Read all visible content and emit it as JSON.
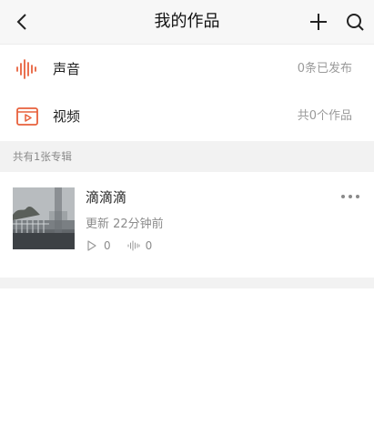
{
  "header": {
    "title": "我的作品",
    "back_icon": "chevron-left-icon",
    "add_icon": "plus-icon",
    "search_icon": "search-icon"
  },
  "rows": [
    {
      "icon": "audio-waveform-icon",
      "label": "声音",
      "meta": "0条已发布",
      "accent": "#e8613c"
    },
    {
      "icon": "video-play-icon",
      "label": "视频",
      "meta": "共0个作品",
      "accent": "#e8613c"
    }
  ],
  "section": {
    "label": "共有1张专辑"
  },
  "albums": [
    {
      "title": "滴滴滴",
      "updated": "更新 22分钟前",
      "plays": "0",
      "tracks": "0",
      "more_icon": "more-horizontal-icon",
      "play_icon": "play-outline-icon",
      "tracks_icon": "audio-waveform-icon"
    }
  ]
}
